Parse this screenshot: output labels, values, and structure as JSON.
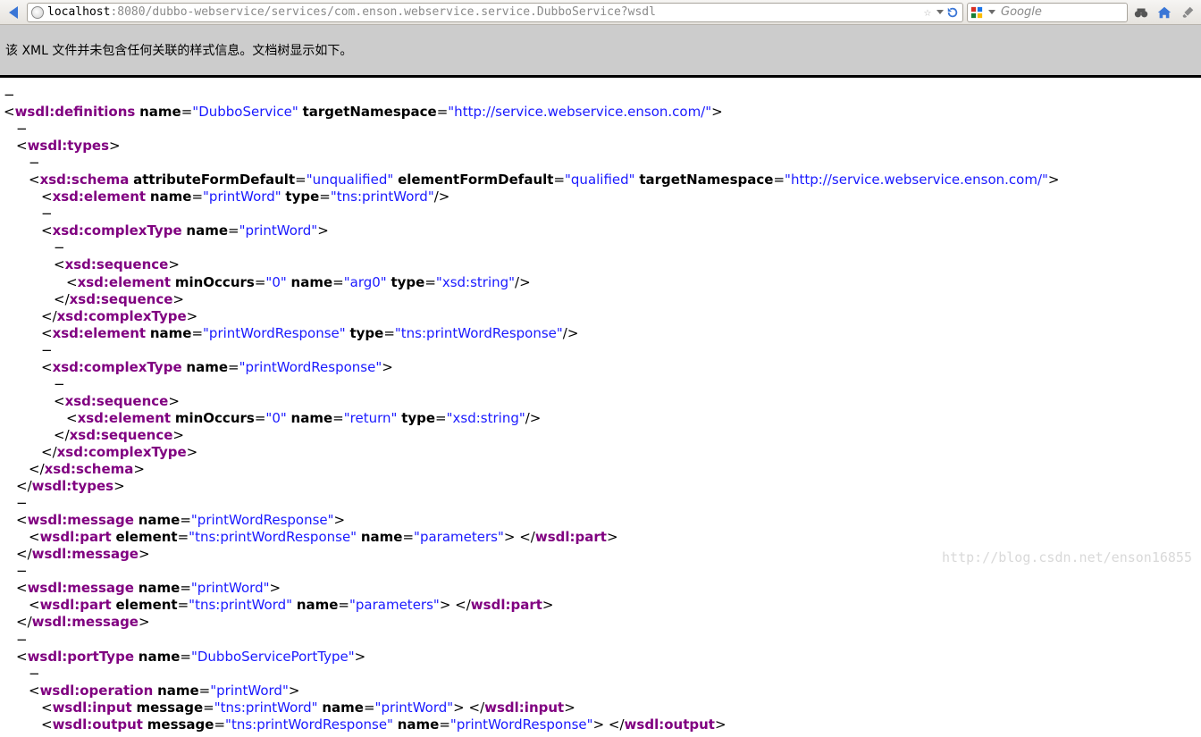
{
  "toolbar": {
    "url_host": "localhost",
    "url_rest": ":8080/dubbo-webservice/services/com.enson.webservice.service.DubboService?wsdl",
    "search_placeholder": "Google"
  },
  "info_strip": "该 XML 文件并未包含任何关联的样式信息。文档树显示如下。",
  "watermark": "http://blog.csdn.net/enson16855",
  "xml_tokens": [
    [
      0,
      "d",
      "−"
    ],
    [
      0,
      "p",
      "<"
    ],
    [
      0,
      "t",
      "wsdl:definitions"
    ],
    [
      0,
      "s",
      " "
    ],
    [
      0,
      "a",
      "name"
    ],
    [
      0,
      "p",
      "="
    ],
    [
      0,
      "v",
      "\"DubboService\""
    ],
    [
      0,
      "s",
      " "
    ],
    [
      0,
      "a",
      "targetNamespace"
    ],
    [
      0,
      "p",
      "="
    ],
    [
      0,
      "v",
      "\"http://service.webservice.enson.com/\""
    ],
    [
      0,
      "p",
      ">"
    ],
    [
      1,
      "d",
      "−"
    ],
    [
      1,
      "p",
      "<"
    ],
    [
      1,
      "t",
      "wsdl:types"
    ],
    [
      1,
      "p",
      ">"
    ],
    [
      2,
      "d",
      "−"
    ],
    [
      2,
      "p",
      "<"
    ],
    [
      2,
      "t",
      "xsd:schema"
    ],
    [
      2,
      "s",
      " "
    ],
    [
      2,
      "a",
      "attributeFormDefault"
    ],
    [
      2,
      "p",
      "="
    ],
    [
      2,
      "v",
      "\"unqualified\""
    ],
    [
      2,
      "s",
      " "
    ],
    [
      2,
      "a",
      "elementFormDefault"
    ],
    [
      2,
      "p",
      "="
    ],
    [
      2,
      "v",
      "\"qualified\""
    ],
    [
      2,
      "s",
      " "
    ],
    [
      2,
      "a",
      "targetNamespace"
    ],
    [
      2,
      "p",
      "="
    ],
    [
      2,
      "v",
      "\"http://service.webservice.enson.com/\""
    ],
    [
      2,
      "p",
      ">"
    ],
    [
      3,
      "p",
      "<"
    ],
    [
      3,
      "t",
      "xsd:element"
    ],
    [
      3,
      "s",
      " "
    ],
    [
      3,
      "a",
      "name"
    ],
    [
      3,
      "p",
      "="
    ],
    [
      3,
      "v",
      "\"printWord\""
    ],
    [
      3,
      "s",
      " "
    ],
    [
      3,
      "a",
      "type"
    ],
    [
      3,
      "p",
      "="
    ],
    [
      3,
      "v",
      "\"tns:printWord\""
    ],
    [
      3,
      "p",
      "/>"
    ],
    [
      3,
      "d",
      "−"
    ],
    [
      3,
      "p",
      "<"
    ],
    [
      3,
      "t",
      "xsd:complexType"
    ],
    [
      3,
      "s",
      " "
    ],
    [
      3,
      "a",
      "name"
    ],
    [
      3,
      "p",
      "="
    ],
    [
      3,
      "v",
      "\"printWord\""
    ],
    [
      3,
      "p",
      ">"
    ],
    [
      4,
      "d",
      "−"
    ],
    [
      4,
      "p",
      "<"
    ],
    [
      4,
      "t",
      "xsd:sequence"
    ],
    [
      4,
      "p",
      ">"
    ],
    [
      5,
      "p",
      "<"
    ],
    [
      5,
      "t",
      "xsd:element"
    ],
    [
      5,
      "s",
      " "
    ],
    [
      5,
      "a",
      "minOccurs"
    ],
    [
      5,
      "p",
      "="
    ],
    [
      5,
      "v",
      "\"0\""
    ],
    [
      5,
      "s",
      " "
    ],
    [
      5,
      "a",
      "name"
    ],
    [
      5,
      "p",
      "="
    ],
    [
      5,
      "v",
      "\"arg0\""
    ],
    [
      5,
      "s",
      " "
    ],
    [
      5,
      "a",
      "type"
    ],
    [
      5,
      "p",
      "="
    ],
    [
      5,
      "v",
      "\"xsd:string\""
    ],
    [
      5,
      "p",
      "/>"
    ],
    [
      4,
      "p",
      "</"
    ],
    [
      4,
      "t",
      "xsd:sequence"
    ],
    [
      4,
      "p",
      ">"
    ],
    [
      3,
      "p",
      "</"
    ],
    [
      3,
      "t",
      "xsd:complexType"
    ],
    [
      3,
      "p",
      ">"
    ],
    [
      3,
      "p",
      "<"
    ],
    [
      3,
      "t",
      "xsd:element"
    ],
    [
      3,
      "s",
      " "
    ],
    [
      3,
      "a",
      "name"
    ],
    [
      3,
      "p",
      "="
    ],
    [
      3,
      "v",
      "\"printWordResponse\""
    ],
    [
      3,
      "s",
      " "
    ],
    [
      3,
      "a",
      "type"
    ],
    [
      3,
      "p",
      "="
    ],
    [
      3,
      "v",
      "\"tns:printWordResponse\""
    ],
    [
      3,
      "p",
      "/>"
    ],
    [
      3,
      "d",
      "−"
    ],
    [
      3,
      "p",
      "<"
    ],
    [
      3,
      "t",
      "xsd:complexType"
    ],
    [
      3,
      "s",
      " "
    ],
    [
      3,
      "a",
      "name"
    ],
    [
      3,
      "p",
      "="
    ],
    [
      3,
      "v",
      "\"printWordResponse\""
    ],
    [
      3,
      "p",
      ">"
    ],
    [
      4,
      "d",
      "−"
    ],
    [
      4,
      "p",
      "<"
    ],
    [
      4,
      "t",
      "xsd:sequence"
    ],
    [
      4,
      "p",
      ">"
    ],
    [
      5,
      "p",
      "<"
    ],
    [
      5,
      "t",
      "xsd:element"
    ],
    [
      5,
      "s",
      " "
    ],
    [
      5,
      "a",
      "minOccurs"
    ],
    [
      5,
      "p",
      "="
    ],
    [
      5,
      "v",
      "\"0\""
    ],
    [
      5,
      "s",
      " "
    ],
    [
      5,
      "a",
      "name"
    ],
    [
      5,
      "p",
      "="
    ],
    [
      5,
      "v",
      "\"return\""
    ],
    [
      5,
      "s",
      " "
    ],
    [
      5,
      "a",
      "type"
    ],
    [
      5,
      "p",
      "="
    ],
    [
      5,
      "v",
      "\"xsd:string\""
    ],
    [
      5,
      "p",
      "/>"
    ],
    [
      4,
      "p",
      "</"
    ],
    [
      4,
      "t",
      "xsd:sequence"
    ],
    [
      4,
      "p",
      ">"
    ],
    [
      3,
      "p",
      "</"
    ],
    [
      3,
      "t",
      "xsd:complexType"
    ],
    [
      3,
      "p",
      ">"
    ],
    [
      2,
      "p",
      "</"
    ],
    [
      2,
      "t",
      "xsd:schema"
    ],
    [
      2,
      "p",
      ">"
    ],
    [
      1,
      "p",
      "</"
    ],
    [
      1,
      "t",
      "wsdl:types"
    ],
    [
      1,
      "p",
      ">"
    ],
    [
      1,
      "d",
      "−"
    ],
    [
      1,
      "p",
      "<"
    ],
    [
      1,
      "t",
      "wsdl:message"
    ],
    [
      1,
      "s",
      " "
    ],
    [
      1,
      "a",
      "name"
    ],
    [
      1,
      "p",
      "="
    ],
    [
      1,
      "v",
      "\"printWordResponse\""
    ],
    [
      1,
      "p",
      ">"
    ],
    [
      2,
      "p",
      "<"
    ],
    [
      2,
      "t",
      "wsdl:part"
    ],
    [
      2,
      "s",
      " "
    ],
    [
      2,
      "a",
      "element"
    ],
    [
      2,
      "p",
      "="
    ],
    [
      2,
      "v",
      "\"tns:printWordResponse\""
    ],
    [
      2,
      "s",
      " "
    ],
    [
      2,
      "a",
      "name"
    ],
    [
      2,
      "p",
      "="
    ],
    [
      2,
      "v",
      "\"parameters\""
    ],
    [
      2,
      "p",
      ">"
    ],
    [
      2,
      "s",
      " "
    ],
    [
      2,
      "p",
      "</"
    ],
    [
      2,
      "t",
      "wsdl:part"
    ],
    [
      2,
      "p",
      ">"
    ],
    [
      1,
      "p",
      "</"
    ],
    [
      1,
      "t",
      "wsdl:message"
    ],
    [
      1,
      "p",
      ">"
    ],
    [
      1,
      "d",
      "−"
    ],
    [
      1,
      "p",
      "<"
    ],
    [
      1,
      "t",
      "wsdl:message"
    ],
    [
      1,
      "s",
      " "
    ],
    [
      1,
      "a",
      "name"
    ],
    [
      1,
      "p",
      "="
    ],
    [
      1,
      "v",
      "\"printWord\""
    ],
    [
      1,
      "p",
      ">"
    ],
    [
      2,
      "p",
      "<"
    ],
    [
      2,
      "t",
      "wsdl:part"
    ],
    [
      2,
      "s",
      " "
    ],
    [
      2,
      "a",
      "element"
    ],
    [
      2,
      "p",
      "="
    ],
    [
      2,
      "v",
      "\"tns:printWord\""
    ],
    [
      2,
      "s",
      " "
    ],
    [
      2,
      "a",
      "name"
    ],
    [
      2,
      "p",
      "="
    ],
    [
      2,
      "v",
      "\"parameters\""
    ],
    [
      2,
      "p",
      ">"
    ],
    [
      2,
      "s",
      " "
    ],
    [
      2,
      "p",
      "</"
    ],
    [
      2,
      "t",
      "wsdl:part"
    ],
    [
      2,
      "p",
      ">"
    ],
    [
      1,
      "p",
      "</"
    ],
    [
      1,
      "t",
      "wsdl:message"
    ],
    [
      1,
      "p",
      ">"
    ],
    [
      1,
      "d",
      "−"
    ],
    [
      1,
      "p",
      "<"
    ],
    [
      1,
      "t",
      "wsdl:portType"
    ],
    [
      1,
      "s",
      " "
    ],
    [
      1,
      "a",
      "name"
    ],
    [
      1,
      "p",
      "="
    ],
    [
      1,
      "v",
      "\"DubboServicePortType\""
    ],
    [
      1,
      "p",
      ">"
    ],
    [
      2,
      "d",
      "−"
    ],
    [
      2,
      "p",
      "<"
    ],
    [
      2,
      "t",
      "wsdl:operation"
    ],
    [
      2,
      "s",
      " "
    ],
    [
      2,
      "a",
      "name"
    ],
    [
      2,
      "p",
      "="
    ],
    [
      2,
      "v",
      "\"printWord\""
    ],
    [
      2,
      "p",
      ">"
    ],
    [
      3,
      "p",
      "<"
    ],
    [
      3,
      "t",
      "wsdl:input"
    ],
    [
      3,
      "s",
      " "
    ],
    [
      3,
      "a",
      "message"
    ],
    [
      3,
      "p",
      "="
    ],
    [
      3,
      "v",
      "\"tns:printWord\""
    ],
    [
      3,
      "s",
      " "
    ],
    [
      3,
      "a",
      "name"
    ],
    [
      3,
      "p",
      "="
    ],
    [
      3,
      "v",
      "\"printWord\""
    ],
    [
      3,
      "p",
      ">"
    ],
    [
      3,
      "s",
      " "
    ],
    [
      3,
      "p",
      "</"
    ],
    [
      3,
      "t",
      "wsdl:input"
    ],
    [
      3,
      "p",
      ">"
    ],
    [
      3,
      "p",
      "<"
    ],
    [
      3,
      "t",
      "wsdl:output"
    ],
    [
      3,
      "s",
      " "
    ],
    [
      3,
      "a",
      "message"
    ],
    [
      3,
      "p",
      "="
    ],
    [
      3,
      "v",
      "\"tns:printWordResponse\""
    ],
    [
      3,
      "s",
      " "
    ],
    [
      3,
      "a",
      "name"
    ],
    [
      3,
      "p",
      "="
    ],
    [
      3,
      "v",
      "\"printWordResponse\""
    ],
    [
      3,
      "p",
      ">"
    ],
    [
      3,
      "s",
      " "
    ],
    [
      3,
      "p",
      "</"
    ],
    [
      3,
      "t",
      "wsdl:output"
    ],
    [
      3,
      "p",
      ">"
    ]
  ]
}
